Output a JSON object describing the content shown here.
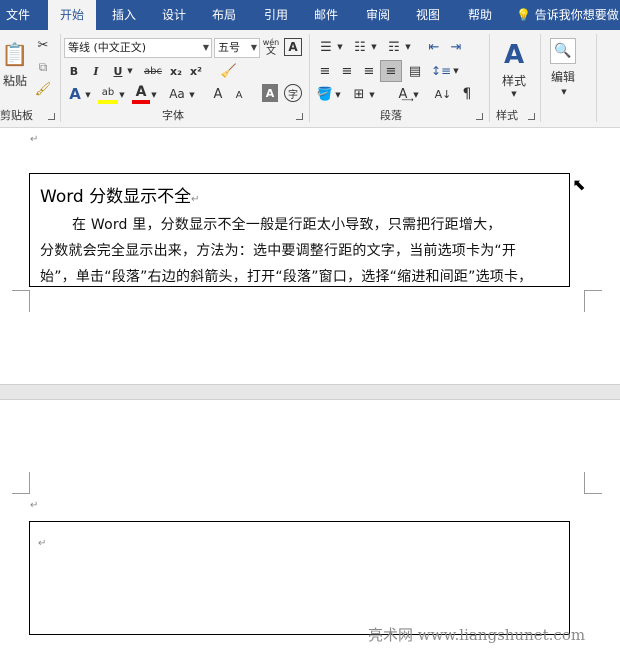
{
  "menubar": {
    "tabs": [
      "文件",
      "开始",
      "插入",
      "设计",
      "布局",
      "引用",
      "邮件",
      "审阅",
      "视图",
      "帮助"
    ],
    "active_tab": "开始",
    "tell_me": "告诉我你想要做"
  },
  "ribbon": {
    "clipboard": {
      "paste_label": "粘贴",
      "group_label": "剪贴板"
    },
    "font": {
      "font_name": "等线 (中文正文)",
      "font_size": "五号",
      "phonetic_label": "wén",
      "phonetic_char": "文",
      "bold": "B",
      "italic": "I",
      "underline": "U",
      "strike": "abc",
      "subscript": "x₂",
      "superscript": "x²",
      "grow": "A",
      "shrink": "A",
      "case": "Aa",
      "group_label": "字体"
    },
    "paragraph": {
      "group_label": "段落"
    },
    "styles": {
      "label": "样式",
      "group_label": "样式"
    },
    "editing": {
      "label": "编辑"
    }
  },
  "document": {
    "heading": "Word 分数显示不全",
    "lines": [
      "在 Word 里，分数显示不全一般是行距太小导致，只需把行距增大，",
      "分数就会完全显示出来，方法为：选中要调整行距的文字，当前选项卡为“开",
      "始”，单击“段落”右边的斜箭头，打开“段落”窗口，选择“缩进和间距”选项卡，"
    ],
    "para_mark": "↵"
  },
  "watermark": "亮术网 www.liangshunet.com"
}
